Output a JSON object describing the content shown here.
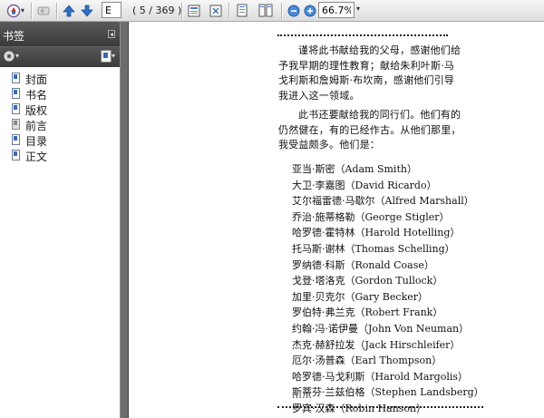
{
  "toolbar": {
    "page_input_value": "E",
    "page_count": "( 5 / 369 )",
    "zoom_value": "66.7%"
  },
  "nav": {
    "title": "书签",
    "bookmarks": [
      {
        "label": "封面"
      },
      {
        "label": "书名"
      },
      {
        "label": "版权"
      },
      {
        "label": "前言"
      },
      {
        "label": "目录"
      },
      {
        "label": "正文"
      }
    ]
  },
  "document": {
    "dedication_1": [
      "谨将此书献给我的父母，感谢他们给",
      "予我早期的理性教育；献给朱利叶斯·马",
      "戈利斯和詹姆斯·布坎南，感谢他们引导",
      "我进入这一领域。"
    ],
    "dedication_2": [
      "此书还要献给我的同行们。他们有的",
      "仍然健在，有的已经作古。从他们那里，",
      "我受益颇多。他们是："
    ],
    "names": [
      "亚当·斯密（Adam Smith）",
      "大卫·李嘉图（David Ricardo）",
      "艾尔福雷德·马歇尔（Alfred Marshall）",
      "乔治·施蒂格勒（George Stigler）",
      "哈罗德·霍特林（Harold Hotelling）",
      "托马斯·谢林（Thomas Schelling）",
      "罗纳德·科斯（Ronald Coase）",
      "戈登·塔洛克（Gordon Tullock）",
      "加里·贝克尔（Gary Becker）",
      "罗伯特·弗兰克（Robert Frank）",
      "约翰·冯·诺伊曼（John Von Neuman）",
      "杰克·赫舒拉发（Jack Hirschleifer）",
      "厄尔·汤普森（Earl Thompson）",
      "哈罗德·马戈利斯（Harold Margolis）",
      "斯蒂芬·兰兹伯格（Stephen Landsberg）",
      "罗宾·汉森（Robin Hanson）"
    ],
    "ellipsis": "……"
  }
}
